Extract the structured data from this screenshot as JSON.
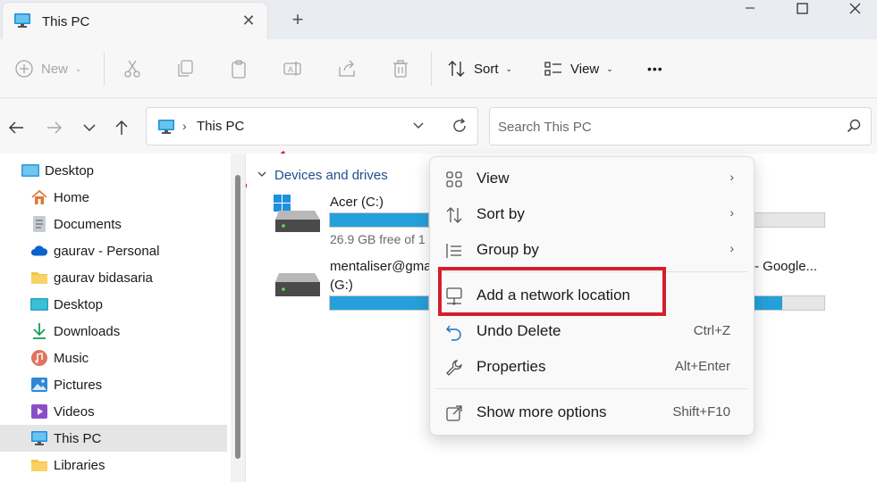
{
  "tab": {
    "title": "This PC",
    "close": "✕",
    "new": "+"
  },
  "window": {
    "min": "—",
    "max": "☐",
    "close": "✕"
  },
  "toolbar": {
    "new_label": "New",
    "sort_label": "Sort",
    "view_label": "View",
    "more": "•••"
  },
  "nav": {
    "breadcrumb": "This PC",
    "search_placeholder": "Search This PC"
  },
  "sidebar": {
    "items": [
      {
        "label": "Desktop",
        "icon": "desktop-icon"
      },
      {
        "label": "Home",
        "icon": "home-icon"
      },
      {
        "label": "Documents",
        "icon": "documents-icon"
      },
      {
        "label": "gaurav - Personal",
        "icon": "onedrive-icon"
      },
      {
        "label": "gaurav bidasaria",
        "icon": "folder-icon"
      },
      {
        "label": "Desktop",
        "icon": "desktop-icon"
      },
      {
        "label": "Downloads",
        "icon": "download-icon"
      },
      {
        "label": "Music",
        "icon": "music-icon"
      },
      {
        "label": "Pictures",
        "icon": "pictures-icon"
      },
      {
        "label": "Videos",
        "icon": "videos-icon"
      },
      {
        "label": "This PC",
        "icon": "this-pc-icon"
      },
      {
        "label": "Libraries",
        "icon": "folder-icon"
      }
    ]
  },
  "main": {
    "group_header": "Devices and drives",
    "drives": [
      {
        "name": "Acer (C:)",
        "free": "26.9 GB free of 1",
        "used_fraction": 0.86
      },
      {
        "name": "mentaliser@gma",
        "name_right": "- Google...",
        "sub": "(G:)",
        "used_fraction": 0.9
      }
    ]
  },
  "context_menu": {
    "items": [
      {
        "label": "View",
        "icon": "view-icon",
        "submenu": "›"
      },
      {
        "label": "Sort by",
        "icon": "sort-icon",
        "submenu": "›"
      },
      {
        "label": "Group by",
        "icon": "group-icon",
        "submenu": "›"
      },
      {
        "label": "Add a network location",
        "icon": "network-location-icon"
      },
      {
        "label": "Undo Delete",
        "icon": "undo-icon",
        "accel": "Ctrl+Z"
      },
      {
        "label": "Properties",
        "icon": "wrench-icon",
        "accel": "Alt+Enter"
      },
      {
        "label": "Show more options",
        "icon": "share-icon",
        "accel": "Shift+F10"
      }
    ]
  },
  "colors": {
    "accent": "#26a0da",
    "highlight": "#d2202a",
    "group_header": "#1f4f8c"
  }
}
